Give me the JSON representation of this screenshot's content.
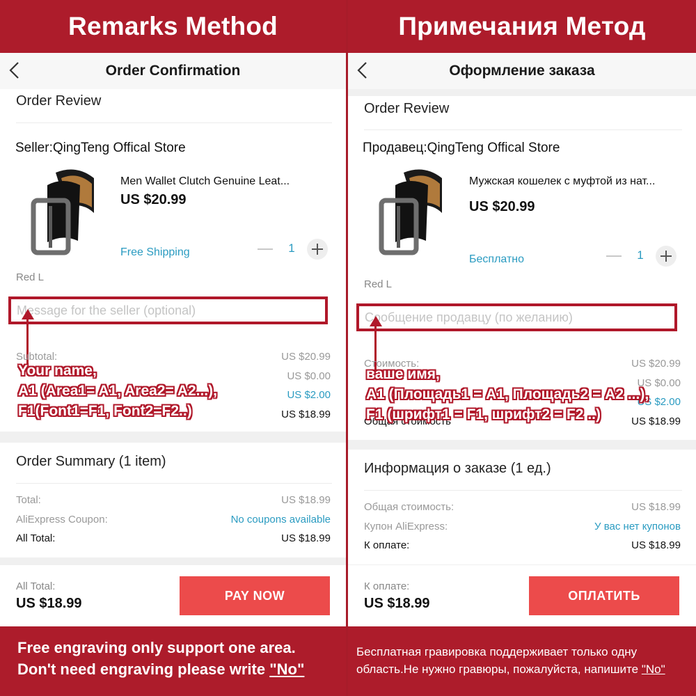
{
  "left": {
    "banner_title": "Remarks Method",
    "nav_title": "Order Confirmation",
    "order_review": "Order Review",
    "seller": "Seller:QingTeng Offical Store",
    "product_name": "Men Wallet Clutch Genuine Leat...",
    "price": "US $20.99",
    "shipping": "Free Shipping",
    "quantity": "1",
    "variant": "Red L",
    "message_placeholder": "Message for the seller (optional)",
    "subtotal_label": "Subtotal:",
    "subtotal_value": "US $20.99",
    "row2_value": "US $0.00",
    "row3_value": "US $2.00",
    "row4_value": "US $18.99",
    "overlay_line1": "Your name,",
    "overlay_line2": "A1 (Area1= A1, Area2= A2...),",
    "overlay_line3": "F1(Font1=F1, Font2=F2..)",
    "summary_title": "Order Summary (1 item)",
    "total_label": "Total:",
    "total_value": "US $18.99",
    "coupon_label": "AliExpress Coupon:",
    "coupon_value": "No coupons available",
    "all_total_label": "All Total:",
    "all_total_value": "US $18.99",
    "bottom_total_label": "All Total:",
    "bottom_total_value": "US $18.99",
    "pay_button": "PAY NOW",
    "note_line1": "Free engraving only support one area.",
    "note_line2_prefix": "Don't need engraving please write ",
    "note_no": "\"No\""
  },
  "right": {
    "banner_title": "Примечания Метод",
    "nav_title": "Оформление заказа",
    "order_review": "Order Review",
    "seller": "Продавец:QingTeng Offical Store",
    "product_name": "Мужская кошелек с муфтой из нат...",
    "price": "US $20.99",
    "shipping": "Бесплатно",
    "quantity": "1",
    "variant": "Red L",
    "message_placeholder": "Сообщение продавцу (по желанию)",
    "subtotal_label": "Стоимость:",
    "subtotal_value": "US $20.99",
    "row2_value": "US $0.00",
    "row3_value": "US $2.00",
    "row4_label": "Общая стоимость",
    "row4_value": "US $18.99",
    "overlay_line1": "ваше имя,",
    "overlay_line2": "A1 (Площадь1 = A1, Площадь2 = A2 ...),",
    "overlay_line3": "F1 (шрифт1 = F1, шрифт2 = F2 ..)",
    "summary_title": "Информация о заказе (1 ед.)",
    "total_label": "Общая стоимость:",
    "total_value": "US $18.99",
    "coupon_label": "Купон AliExpress:",
    "coupon_value": "У вас нет купонов",
    "all_total_label": "К оплате:",
    "all_total_value": "US $18.99",
    "bottom_total_label": "К оплате:",
    "bottom_total_value": "US $18.99",
    "pay_button": "ОПЛАТИТЬ",
    "note_line1": "Бесплатная гравировка поддерживает только одну",
    "note_line2_prefix": "область.Не нужно гравюры, пожалуйста, напишите ",
    "note_no": "\"No\""
  },
  "colors": {
    "banner": "#ad1c2b",
    "highlight_box": "#b0182a",
    "link_blue": "#2a9bc1",
    "pay_button": "#ec4b4b"
  },
  "icons": [
    "back-chevron-icon",
    "minus-icon",
    "plus-icon",
    "belt-product-image",
    "arrow-up-icon"
  ]
}
